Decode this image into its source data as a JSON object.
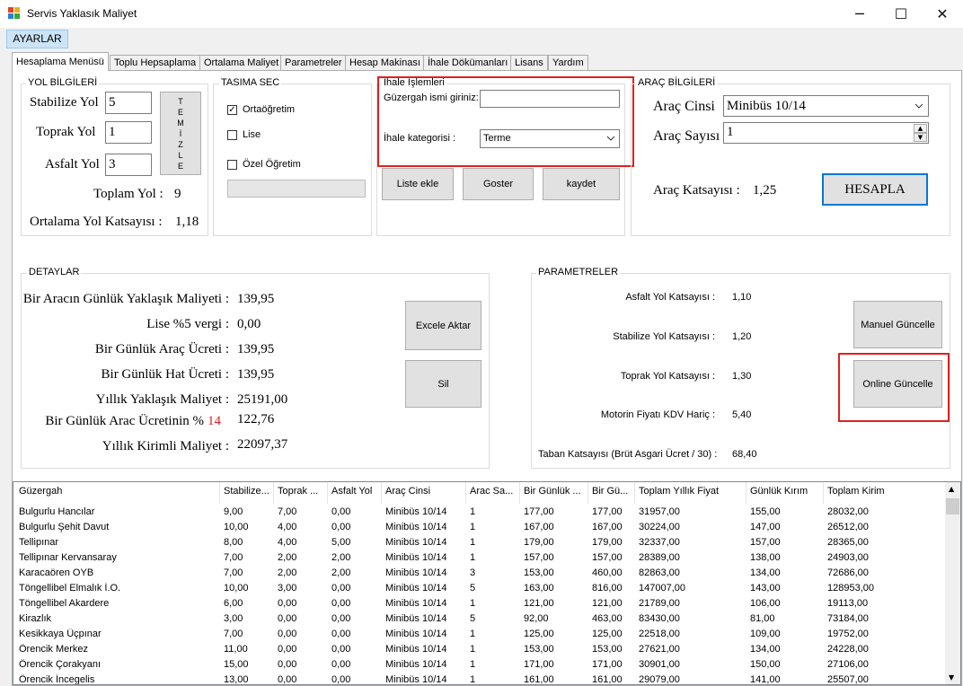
{
  "window": {
    "title": "Servis Yaklasık Maliyet",
    "minimize": "─",
    "maximize": "☐",
    "close": "✕"
  },
  "menu": {
    "ayarlar": "AYARLAR"
  },
  "tabs": [
    "Hesaplama Menüsü",
    "Toplu Hepsaplama",
    "Ortalama Maliyet",
    "Parametreler",
    "Hesap Makinası",
    "İhale Dökümanları",
    "Lisans",
    "Yardım"
  ],
  "yol": {
    "group": "YOL BİLGİLERİ",
    "stabilize_label": "Stabilize Yol",
    "stabilize_value": "5",
    "toprak_label": "Toprak Yol",
    "toprak_value": "1",
    "asfalt_label": "Asfalt Yol",
    "asfalt_value": "3",
    "temizle": [
      "T",
      "E",
      "M",
      "İ",
      "Z",
      "L",
      "E"
    ],
    "toplam_label": "Toplam Yol :",
    "toplam_value": "9",
    "ortalama_label": "Ortalama Yol Katsayısı :",
    "ortalama_value": "1,18"
  },
  "tasima": {
    "group": "TASIMA SEC",
    "opt1": "Ortaöğretim",
    "opt1_checked": true,
    "opt2": "Lise",
    "opt2_checked": false,
    "opt3": "Özel Öğretim",
    "opt3_checked": false
  },
  "ihale": {
    "group": "İhale İşlemleri",
    "guzergah_label": "Güzergah ismi giriniz:",
    "guzergah_value": "",
    "kategori_label": "İhale kategorisi :",
    "kategori_value": "Terme",
    "liste_ekle": "Liste ekle",
    "goster": "Goster",
    "kaydet": "kaydet"
  },
  "arac": {
    "group": "ARAÇ BİLGİLERİ",
    "cinsi_label": "Araç Cinsi",
    "cinsi_value": "Minibüs 10/14",
    "sayisi_label": "Araç Sayısı",
    "sayisi_value": "1",
    "katsayi_label": "Araç Katsayısı :",
    "katsayi_value": "1,25",
    "hesapla": "HESAPLA"
  },
  "detay": {
    "group": "DETAYLAR",
    "rows": [
      {
        "label": "Bir Aracın Günlük Yaklaşık Maliyeti :",
        "value": "139,95"
      },
      {
        "label": "Lise %5 vergi :",
        "value": "0,00"
      },
      {
        "label": "Bir Günlük Araç Ücreti :",
        "value": "139,95"
      },
      {
        "label": "Bir Günlük Hat Ücreti :",
        "value": "139,95"
      },
      {
        "label": "Yıllık Yaklaşık Maliyet :",
        "value": "25191,00"
      },
      {
        "label": "Bir Günlük Arac Ücretinin %",
        "value": "122,76"
      },
      {
        "label": "Yıllık Kirimli Maliyet :",
        "value": "22097,37"
      }
    ],
    "percent_value": "14",
    "excel": "Excele Aktar",
    "sil": "Sil"
  },
  "params": {
    "group": "PARAMETRELER",
    "rows": [
      {
        "label": "Asfalt Yol Katsayısı :",
        "value": "1,10"
      },
      {
        "label": "Stabilize Yol Katsayısı :",
        "value": "1,20"
      },
      {
        "label": "Toprak Yol Katsayısı :",
        "value": "1,30"
      },
      {
        "label": "Motorin Fiyatı KDV Hariç :",
        "value": "5,40"
      },
      {
        "label": "Taban Katsayısı (Brüt Asgari Ücret / 30) :",
        "value": "68,40"
      }
    ],
    "manuel": "Manuel Güncelle",
    "online": "Online Güncelle"
  },
  "colors": {
    "red_highlight": "#e02020",
    "hesapla_border": "#0078d7",
    "percent_red": "#e02020"
  },
  "table": {
    "headers": [
      "Güzergah",
      "Stabilize...",
      "Toprak ...",
      "Asfalt Yol",
      "Araç Cinsi",
      "Arac Sa...",
      "Bir Günlük ...",
      "Bir Gü...",
      "Toplam Yıllık Fiyat",
      "Günlük Kırım",
      "Toplam Kirim"
    ],
    "rows": [
      [
        "Bulgurlu Hancılar",
        "9,00",
        "7,00",
        "0,00",
        "Minibüs 10/14",
        "1",
        "177,00",
        "177,00",
        "31957,00",
        "155,00",
        "28032,00"
      ],
      [
        "Bulgurlu Şehit Davut",
        "10,00",
        "4,00",
        "0,00",
        "Minibüs 10/14",
        "1",
        "167,00",
        "167,00",
        "30224,00",
        "147,00",
        "26512,00"
      ],
      [
        "Tellipınar",
        "8,00",
        "4,00",
        "5,00",
        "Minibüs 10/14",
        "1",
        "179,00",
        "179,00",
        "32337,00",
        "157,00",
        "28365,00"
      ],
      [
        "Tellipınar Kervansaray",
        "7,00",
        "2,00",
        "2,00",
        "Minibüs 10/14",
        "1",
        "157,00",
        "157,00",
        "28389,00",
        "138,00",
        "24903,00"
      ],
      [
        "Karacaören OYB",
        "7,00",
        "2,00",
        "2,00",
        "Minibüs 10/14",
        "3",
        "153,00",
        "460,00",
        "82863,00",
        "134,00",
        "72686,00"
      ],
      [
        "Töngellibel Elmalık İ.O.",
        "10,00",
        "3,00",
        "0,00",
        "Minibüs 10/14",
        "5",
        "163,00",
        "816,00",
        "147007,00",
        "143,00",
        "128953,00"
      ],
      [
        "Töngellibel Akardere",
        "6,00",
        "0,00",
        "0,00",
        "Minibüs 10/14",
        "1",
        "121,00",
        "121,00",
        "21789,00",
        "106,00",
        "19113,00"
      ],
      [
        "Kirazlık",
        "3,00",
        "0,00",
        "0,00",
        "Minibüs 10/14",
        "5",
        "92,00",
        "463,00",
        "83430,00",
        "81,00",
        "73184,00"
      ],
      [
        "Kesikkaya Üçpınar",
        "7,00",
        "0,00",
        "0,00",
        "Minibüs 10/14",
        "1",
        "125,00",
        "125,00",
        "22518,00",
        "109,00",
        "19752,00"
      ],
      [
        "Örencik Merkez",
        "11,00",
        "0,00",
        "0,00",
        "Minibüs 10/14",
        "1",
        "153,00",
        "153,00",
        "27621,00",
        "134,00",
        "24228,00"
      ],
      [
        "Örencik Çorakyanı",
        "15,00",
        "0,00",
        "0,00",
        "Minibüs 10/14",
        "1",
        "171,00",
        "171,00",
        "30901,00",
        "150,00",
        "27106,00"
      ],
      [
        "Örencik İncegelis",
        "13,00",
        "0,00",
        "0,00",
        "Minibüs 10/14",
        "1",
        "161,00",
        "161,00",
        "29079,00",
        "141,00",
        "25507,00"
      ]
    ]
  }
}
